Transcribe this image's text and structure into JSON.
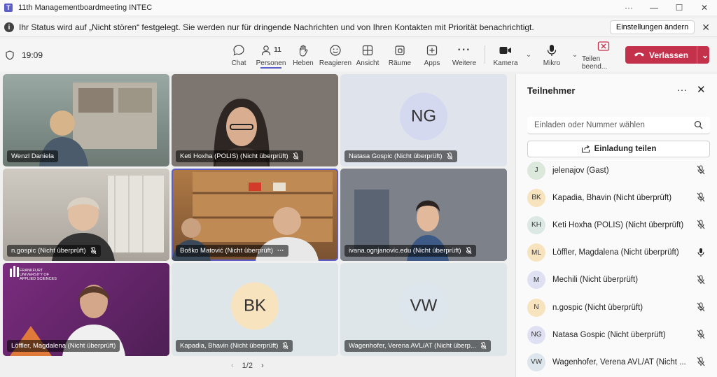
{
  "window": {
    "title": "11th Managementboardmeeting INTEC"
  },
  "banner": {
    "message": "Ihr Status wird auf „Nicht stören“ festgelegt. Sie werden nur für dringende Nachrichten und von Ihren Kontakten mit Priorität benachrichtigt.",
    "settings_button": "Einstellungen ändern"
  },
  "toolbar": {
    "time": "19:09",
    "chat": "Chat",
    "people": "Personen",
    "people_count": "11",
    "raise": "Heben",
    "react": "Reagieren",
    "view": "Ansicht",
    "rooms": "Räume",
    "apps": "Apps",
    "more": "Weitere",
    "camera": "Kamera",
    "mic": "Mikro",
    "share_end": "Teilen beend...",
    "leave": "Verlassen"
  },
  "tiles": [
    {
      "name": "Wenzl Daniela",
      "mic": "none",
      "bg": "#8d9a8f"
    },
    {
      "name": "Keti Hoxha (POLIS) (Nicht überprüft)",
      "mic": "off",
      "bg": "#6f6a66"
    },
    {
      "name": "Natasa Gospic (Nicht überprüft)",
      "mic": "off",
      "initials": "NG",
      "avatar_color": "#d5d9ef",
      "bg": "#dfe4ec"
    },
    {
      "name": "n.gospic (Nicht überprüft)",
      "mic": "off",
      "bg": "#a8a39d"
    },
    {
      "name": "Boško Matović (Nicht überprüft)",
      "mic": "more",
      "bg": "#9c6b3f"
    },
    {
      "name": "ivana.ognjanovic.edu (Nicht überprüft)",
      "mic": "off",
      "bg": "#6e7480"
    },
    {
      "name": "Löffler, Magdalena (Nicht überprüft)",
      "mic": "none",
      "bg": "#6b2d6e",
      "logo_text": "FRANKFURT UNIVERSITY OF APPLIED SCIENCES"
    },
    {
      "name": "Kapadia, Bhavin (Nicht überprüft)",
      "mic": "off",
      "initials": "BK",
      "avatar_color": "#f8e3bf",
      "bg": "#dfe6ea"
    },
    {
      "name": "Wagenhofer, Verena AVL/AT (Nicht überp...",
      "mic": "off",
      "initials": "VW",
      "avatar_color": "#dde6ec",
      "bg": "#dfe6ea"
    }
  ],
  "pager": {
    "label": "1/2"
  },
  "panel": {
    "title": "Teilnehmer",
    "search_placeholder": "Einladen oder Nummer wählen",
    "share_label": "Einladung teilen",
    "participants": [
      {
        "initials": "J",
        "name": "jelenajov (Gast)",
        "color": "#dce8dc",
        "mic": "off"
      },
      {
        "initials": "BK",
        "name": "Kapadia, Bhavin (Nicht überprüft)",
        "color": "#f8e3bf",
        "mic": "off"
      },
      {
        "initials": "KH",
        "name": "Keti Hoxha (POLIS) (Nicht überprüft)",
        "color": "#dce8e4",
        "mic": "off"
      },
      {
        "initials": "ML",
        "name": "Löffler, Magdalena (Nicht überprüft)",
        "color": "#f8e3bf",
        "mic": "on"
      },
      {
        "initials": "M",
        "name": "Mechili (Nicht überprüft)",
        "color": "#dfe1f3",
        "mic": "off"
      },
      {
        "initials": "N",
        "name": "n.gospic (Nicht überprüft)",
        "color": "#f8e3bf",
        "mic": "off"
      },
      {
        "initials": "NG",
        "name": "Natasa Gospic (Nicht überprüft)",
        "color": "#dfe1f3",
        "mic": "off"
      },
      {
        "initials": "VW",
        "name": "Wagenhofer, Verena AVL/AT (Nicht ...",
        "color": "#dde6ec",
        "mic": "off"
      }
    ]
  },
  "colors": {
    "accent": "#5b5fc7",
    "leave": "#c4314b"
  }
}
